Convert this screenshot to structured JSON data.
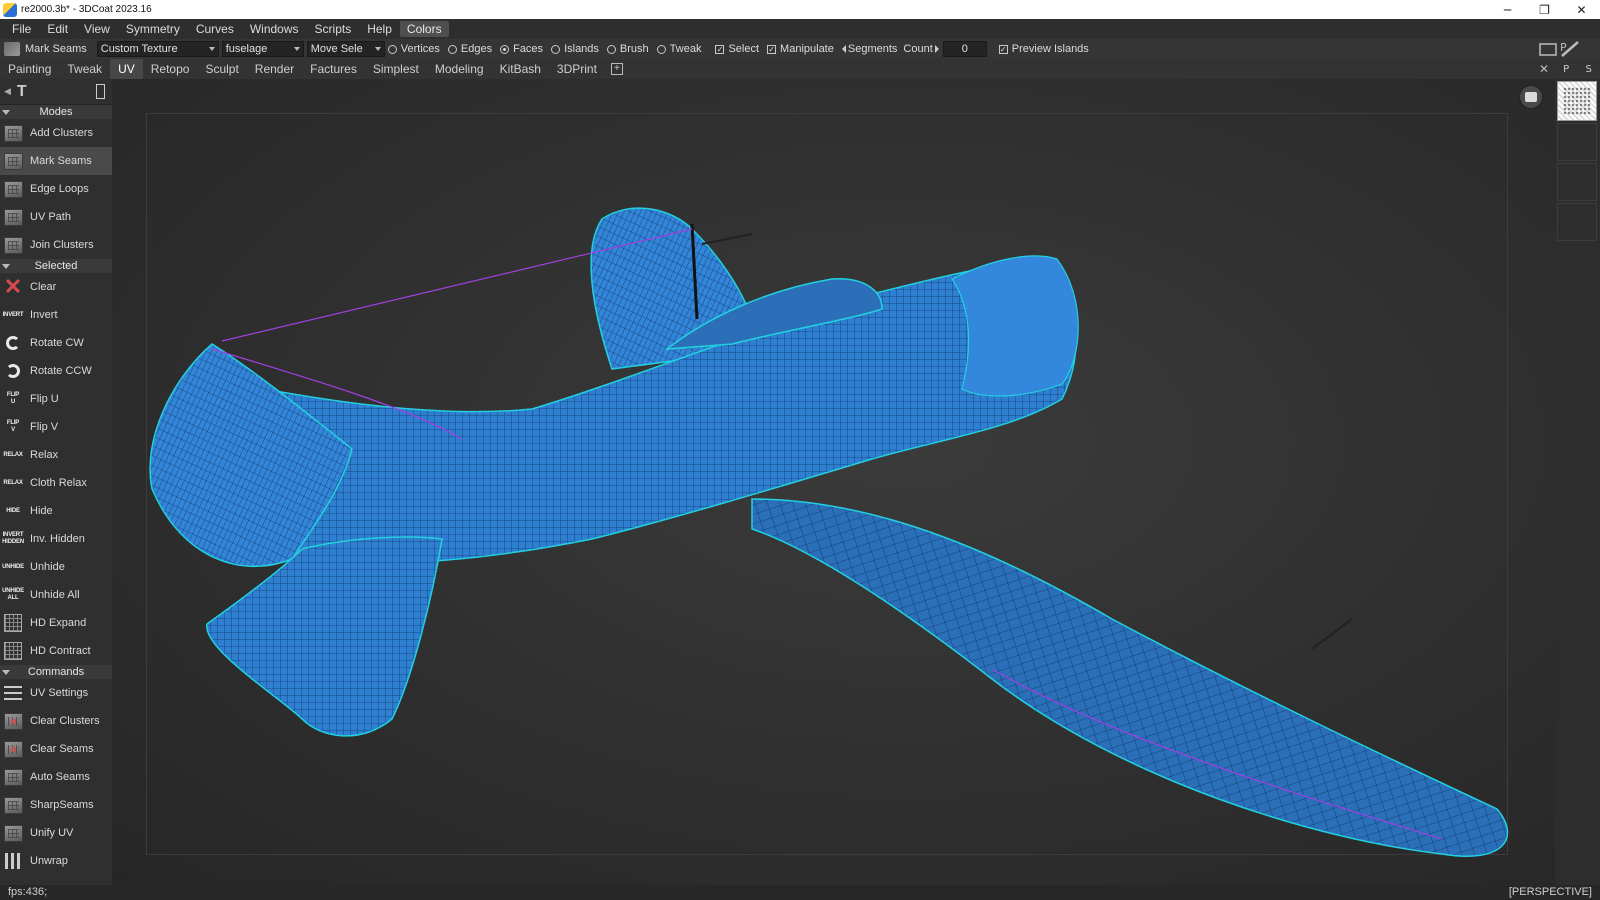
{
  "window": {
    "title": "re2000.3b* - 3DCoat 2023.16",
    "minimize": "─",
    "restore": "❐",
    "close": "✕"
  },
  "menu": [
    "File",
    "Edit",
    "View",
    "Symmetry",
    "Curves",
    "Windows",
    "Scripts",
    "Help",
    "Colors"
  ],
  "toolbar": {
    "mode_label": "Mark Seams",
    "texture_combo": "Custom Texture",
    "object_combo": "fuselage",
    "move_combo": "Move  Sele",
    "radios": [
      {
        "label": "Vertices",
        "checked": false
      },
      {
        "label": "Edges",
        "checked": false
      },
      {
        "label": "Faces",
        "checked": true
      },
      {
        "label": "Islands",
        "checked": false
      },
      {
        "label": "Brush",
        "checked": false
      },
      {
        "label": "Tweak",
        "checked": false
      }
    ],
    "checks": [
      {
        "label": "Select",
        "checked": true
      },
      {
        "label": "Manipulate",
        "checked": true
      }
    ],
    "segments_label": "Segments",
    "count_label": "Count",
    "count_value": "0",
    "preview_label": "Preview  Islands",
    "preview_checked": true
  },
  "tabs": [
    "Painting",
    "Tweak",
    "UV",
    "Retopo",
    "Sculpt",
    "Render",
    "Factures",
    "Simplest",
    "Modeling",
    "KitBash",
    "3DPrint"
  ],
  "active_tab": "UV",
  "left_panel": {
    "sections": {
      "modes": "Modes",
      "selected": "Selected",
      "commands": "Commands"
    },
    "modes": [
      {
        "label": "Add  Clusters",
        "icon": "add-clusters-icon"
      },
      {
        "label": "Mark  Seams",
        "icon": "mark-seams-icon",
        "selected": true
      },
      {
        "label": "Edge  Loops",
        "icon": "edge-loops-icon"
      },
      {
        "label": "UV  Path",
        "icon": "uv-path-icon"
      },
      {
        "label": "Join  Clusters",
        "icon": "join-clusters-icon"
      }
    ],
    "selected": [
      {
        "label": "Clear",
        "icon": "clear-x-icon",
        "glyph": "✕"
      },
      {
        "label": "Invert",
        "icon": "invert-icon",
        "glyph": "INVERT"
      },
      {
        "label": "Rotate  CW",
        "icon": "rotate-cw-icon"
      },
      {
        "label": "Rotate  CCW",
        "icon": "rotate-ccw-icon"
      },
      {
        "label": "Flip  U",
        "icon": "flip-u-icon",
        "glyph": "FLIP U"
      },
      {
        "label": "Flip  V",
        "icon": "flip-v-icon",
        "glyph": "FLIP V"
      },
      {
        "label": "Relax",
        "icon": "relax-icon",
        "glyph": "RELAX"
      },
      {
        "label": "Cloth  Relax",
        "icon": "cloth-relax-icon",
        "glyph": "RELAX"
      },
      {
        "label": "Hide",
        "icon": "hide-icon",
        "glyph": "HIDE"
      },
      {
        "label": "Inv.  Hidden",
        "icon": "invert-hidden-icon",
        "glyph": "INVERT HIDDEN"
      },
      {
        "label": "Unhide",
        "icon": "unhide-icon",
        "glyph": "UNHIDE"
      },
      {
        "label": "Unhide  All",
        "icon": "unhide-all-icon",
        "glyph": "UNHIDE ALL"
      },
      {
        "label": "HD  Expand",
        "icon": "hd-expand-icon"
      },
      {
        "label": "HD  Contract",
        "icon": "hd-contract-icon"
      }
    ],
    "commands": [
      {
        "label": "UV  Settings",
        "icon": "uv-settings-icon"
      },
      {
        "label": "Clear  Clusters",
        "icon": "clear-clusters-icon"
      },
      {
        "label": "Clear  Seams",
        "icon": "clear-seams-icon"
      },
      {
        "label": "Auto  Seams",
        "icon": "auto-seams-icon"
      },
      {
        "label": "SharpSeams",
        "icon": "sharp-seams-icon"
      },
      {
        "label": "Unify  UV",
        "icon": "unify-uv-icon"
      },
      {
        "label": "Unwrap",
        "icon": "unwrap-icon"
      }
    ]
  },
  "right_panel": {
    "p": "P",
    "s": "S"
  },
  "status": {
    "fps": "fps:436;",
    "view": "[PERSPECTIVE]"
  },
  "colors": {
    "mesh_fill": "#2f7fd0",
    "mesh_wire": "#0a2a55",
    "seam": "#22d0e0",
    "seam_selected": "#a040e0"
  }
}
